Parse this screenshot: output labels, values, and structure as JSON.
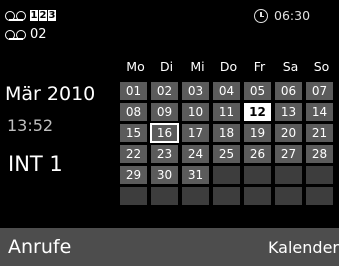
{
  "messages": {
    "row1_boxes": [
      "1",
      "2",
      "3"
    ],
    "row2_count": "02"
  },
  "alarm": {
    "time": "06:30"
  },
  "status": {
    "month": "Mär 2010",
    "time": "13:52",
    "internal": "INT 1"
  },
  "calendar": {
    "weekdays": [
      "Mo",
      "Di",
      "Mi",
      "Do",
      "Fr",
      "Sa",
      "So"
    ],
    "rows": [
      [
        "01",
        "02",
        "03",
        "04",
        "05",
        "06",
        "07"
      ],
      [
        "08",
        "09",
        "10",
        "11",
        "12",
        "13",
        "14"
      ],
      [
        "15",
        "16",
        "17",
        "18",
        "19",
        "20",
        "21"
      ],
      [
        "22",
        "23",
        "24",
        "25",
        "26",
        "27",
        "28"
      ],
      [
        "29",
        "30",
        "31",
        "",
        "",
        "",
        ""
      ],
      [
        "",
        "",
        "",
        "",
        "",
        "",
        ""
      ]
    ],
    "today": "12",
    "selected": "16"
  },
  "softkeys": {
    "left": "Anrufe",
    "right": "Kalender"
  },
  "colors": {
    "background": "#000000",
    "cell": "#5b5b5b",
    "softkey_bar": "#4d4d4d"
  }
}
